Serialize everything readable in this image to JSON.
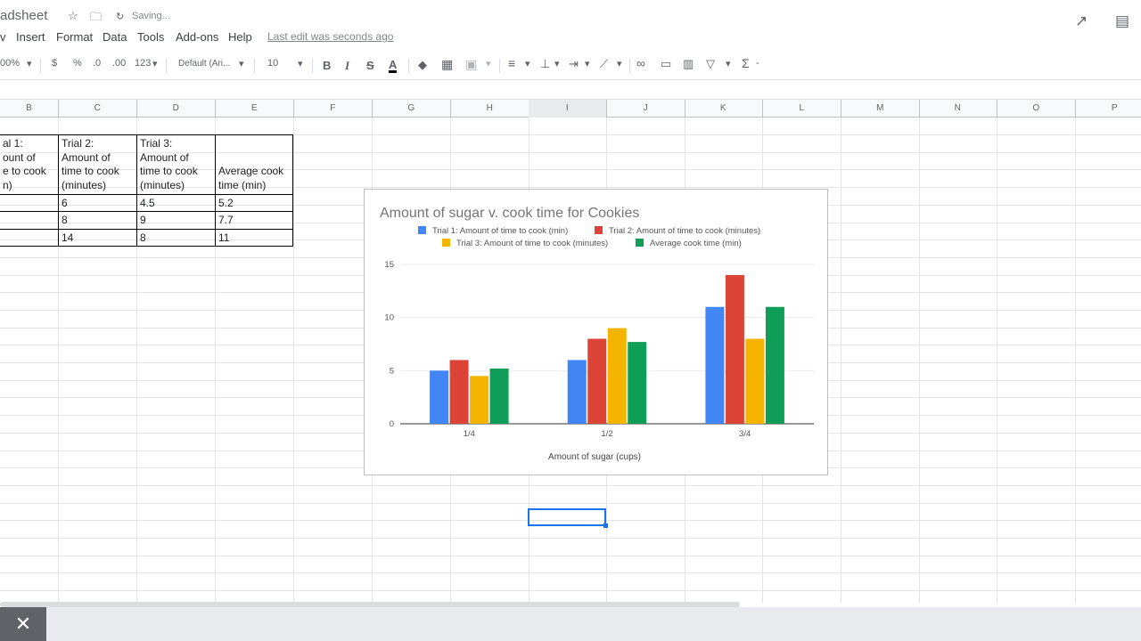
{
  "titlebar": {
    "doc_title": "adsheet",
    "status": "Saving..."
  },
  "menu": {
    "items": [
      "v",
      "Insert",
      "Format",
      "Data",
      "Tools",
      "Add-ons",
      "Help"
    ],
    "last_edit": "Last edit was seconds ago"
  },
  "toolbar": {
    "zoom": "00%",
    "currency": "$",
    "percent": "%",
    "dec_decrease": ".0",
    "dec_increase": ".00",
    "number_format": "123",
    "font": "Default (Ari...",
    "font_size": "10",
    "bold": "B",
    "italic": "I",
    "strike": "S",
    "text_color": "A",
    "function": "Σ"
  },
  "columns": [
    "B",
    "C",
    "D",
    "E",
    "F",
    "G",
    "H",
    "I",
    "J",
    "K",
    "L",
    "M",
    "N",
    "O",
    "P"
  ],
  "table": {
    "headers": [
      "al 1:\nount of\ne to cook\nn)",
      "Trial 2:\nAmount of\ntime to cook\n(minutes)",
      "Trial 3:\nAmount of\ntime to cook\n(minutes)",
      "Average cook\ntime (min)"
    ],
    "rows": [
      [
        "",
        "6",
        "4.5",
        "5.2"
      ],
      [
        "",
        "8",
        "9",
        "7.7"
      ],
      [
        "",
        "14",
        "8",
        "11"
      ]
    ]
  },
  "chart_data": {
    "type": "bar",
    "title": "Amount of sugar v. cook time for Cookies",
    "xlabel": "Amount of sugar (cups)",
    "ylabel": "",
    "categories": [
      "1/4",
      "1/2",
      "3/4"
    ],
    "ylim": [
      0,
      15
    ],
    "yticks": [
      "0",
      "5",
      "10",
      "15"
    ],
    "grid": true,
    "legend_position": "top",
    "series": [
      {
        "name": "Trial 1: Amount of time to cook (min)",
        "values": [
          5,
          6,
          11
        ],
        "color": "#4285f4"
      },
      {
        "name": "Trial 2: Amount of time to cook (minutes)",
        "values": [
          6,
          8,
          14
        ],
        "color": "#db4437"
      },
      {
        "name": "Trial 3: Amount of time to cook (minutes)",
        "values": [
          4.5,
          9,
          8
        ],
        "color": "#f4b400"
      },
      {
        "name": "Average cook time (min)",
        "values": [
          5.2,
          7.7,
          11
        ],
        "color": "#0f9d58"
      }
    ]
  },
  "bottom": {
    "close_label": "✕"
  }
}
